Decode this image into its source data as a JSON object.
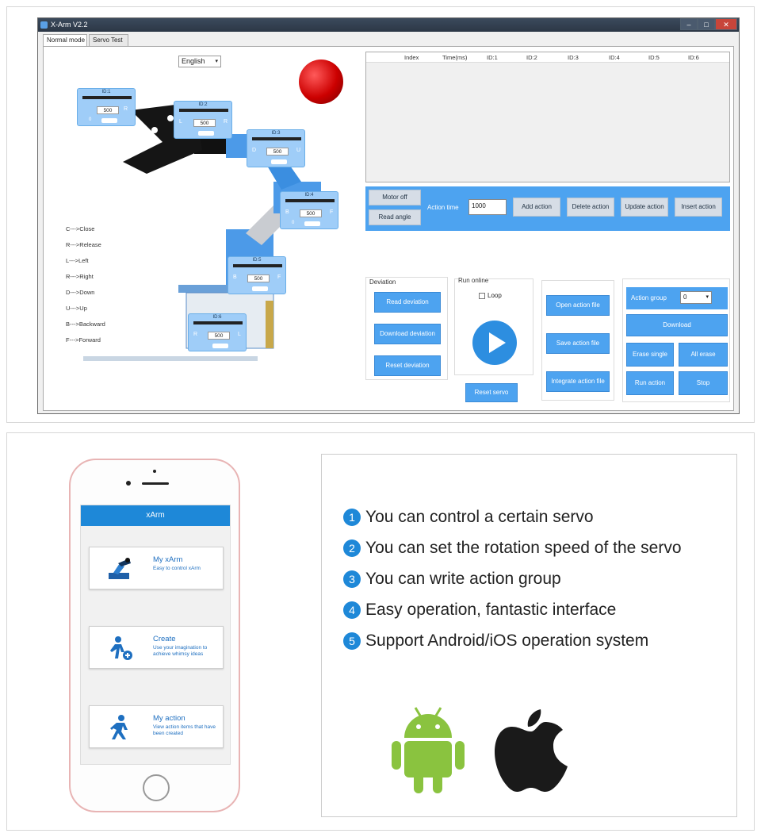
{
  "window": {
    "title": "X-Arm V2.2"
  },
  "tabs": [
    "Normal mode",
    "Servo Test"
  ],
  "language": {
    "selected": "English"
  },
  "legend": [
    "C--->Close",
    "R--->Release",
    "L--->Left",
    "R--->Right",
    "D--->Down",
    "U--->Up",
    "B--->Backward",
    "F--->Forward"
  ],
  "servos": [
    {
      "label": "ID:1",
      "value": "500",
      "left": "",
      "right": "R",
      "bottom": "0"
    },
    {
      "label": "ID:2",
      "value": "500",
      "left": "L",
      "right": "R",
      "bottom": ""
    },
    {
      "label": "ID:3",
      "value": "500",
      "left": "D",
      "right": "U",
      "bottom": ""
    },
    {
      "label": "ID:4",
      "value": "500",
      "left": "B",
      "right": "F",
      "bottom": "0"
    },
    {
      "label": "ID:5",
      "value": "500",
      "left": "B",
      "right": "F",
      "bottom": ""
    },
    {
      "label": "ID:6",
      "value": "500",
      "left": "R",
      "right": "L",
      "bottom": ""
    }
  ],
  "table": {
    "columns": [
      "Index",
      "Time(ms)",
      "ID:1",
      "ID:2",
      "ID:3",
      "ID:4",
      "ID:5",
      "ID:6"
    ]
  },
  "action_bar": {
    "motor_off": "Motor off",
    "read_angle": "Read angle",
    "action_time_label": "Action time",
    "action_time_value": "1000",
    "add_action": "Add action",
    "delete_action": "Delete action",
    "update_action": "Update action",
    "insert_action": "Insert action"
  },
  "deviation": {
    "title": "Deviation",
    "read": "Read deviation",
    "download": "Download deviation",
    "reset": "Reset deviation"
  },
  "run_online": {
    "title": "Run online",
    "loop": "Loop",
    "reset_servo": "Reset servo"
  },
  "files": {
    "open": "Open action file",
    "save": "Save action file",
    "integrate": "Integrate action file"
  },
  "group": {
    "label": "Action group",
    "value": "0",
    "download": "Download",
    "erase_single": "Erase single",
    "all_erase": "All erase",
    "run_action": "Run action",
    "stop": "Stop"
  },
  "phone": {
    "app_title": "xArm",
    "cards": [
      {
        "title": "My xArm",
        "subtitle": "Easy to control xArm"
      },
      {
        "title": "Create",
        "subtitle": "Use your imagination to achieve whimsy ideas"
      },
      {
        "title": "My action",
        "subtitle": "View action items that have been created"
      }
    ]
  },
  "features": [
    {
      "num": "1",
      "text": "You can control a certain servo"
    },
    {
      "num": "2",
      "text": "You can set the rotation speed of the servo"
    },
    {
      "num": "3",
      "text": "You can write action group"
    },
    {
      "num": "4",
      "text": "Easy operation, fantastic interface"
    },
    {
      "num": "5",
      "text": "Support Android/iOS operation system"
    }
  ],
  "colors": {
    "accent": "#4da3f0",
    "app_bar": "#1e88d8",
    "android": "#8ac33f",
    "apple": "#1a1a1a"
  }
}
